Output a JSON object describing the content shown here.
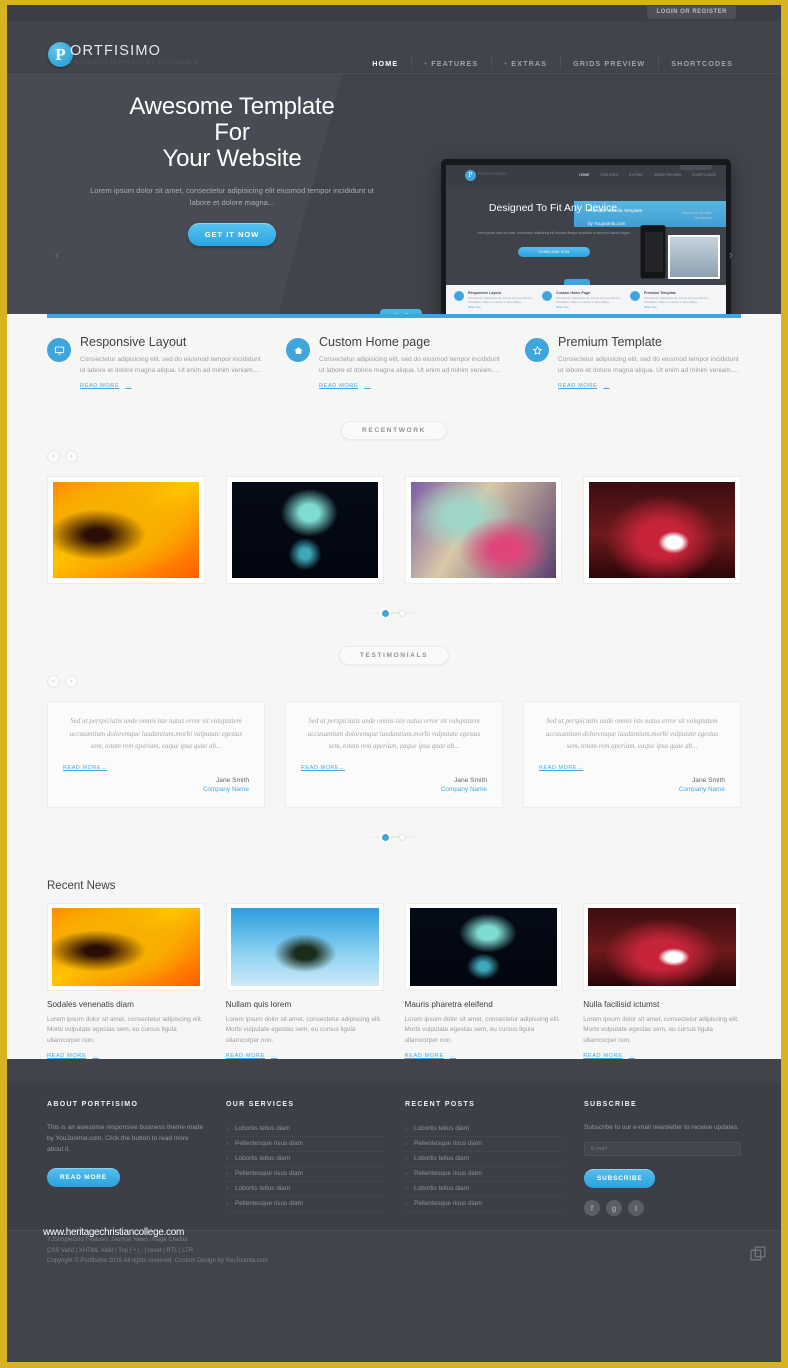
{
  "topbar": {
    "login_label": "LOGIN OR REGISTER"
  },
  "header": {
    "logo_initial": "P",
    "logo_name": "ORTFISIMO",
    "logo_tagline": "PORTFOLIO TEMPLATE BY YOUJOOMLA",
    "nav": [
      {
        "label": "HOME",
        "active": true,
        "caret": ""
      },
      {
        "label": "FEATURES",
        "active": false,
        "caret": "+"
      },
      {
        "label": "EXTRAS",
        "active": false,
        "caret": "+"
      },
      {
        "label": "GRIDS PREVIEW",
        "active": false,
        "caret": ""
      },
      {
        "label": "SHORTCODES",
        "active": false,
        "caret": ""
      }
    ]
  },
  "hero": {
    "title_line1": "Awesome Template",
    "title_line2": "For",
    "title_line3": "Your Website",
    "paragraph": "Lorem ipsum dolor sit amet, consectetur adipisicing elit eiusmod tempor incididunt ut labore et dolore magna...",
    "cta_label": "GET IT NOW",
    "prev_arrow": "‹",
    "next_arrow": "›"
  },
  "monitor": {
    "logo_initial": "P",
    "logo_text": "PORTFISIMO",
    "nav": [
      "HOME",
      "FEATURES",
      "EXTRAS",
      "GRIDS PREVIEW",
      "SHORTCODES"
    ],
    "headline": "Designed To Fit Any Device",
    "paragraph": "Lorem ipsum dolor sit amet, consectetur adipisicing elit eiusmod tempor incididunt ut labore et dolore magna.",
    "button": "DOWNLOAD NOW",
    "banner_line1": "Premium Joomla Template",
    "banner_line2": "by Youjoomla.com",
    "side_line1": "Responsive Template",
    "side_line2": "Your Website",
    "features": [
      {
        "title": "Responsive Layout",
        "text": "Consectetur adipisicing elit, sed do eiusmod tempor incididunt ut labore et dolore magna aliqua.",
        "link": "Read more"
      },
      {
        "title": "Custom Home Page",
        "text": "Consectetur adipisicing elit, sed do eiusmod tempor incididunt ut labore et dolore magna aliqua.",
        "link": "Read more"
      },
      {
        "title": "Premium Template",
        "text": "Consectetur adipisicing elit, sed do eiusmod tempor incididunt ut labore et dolore magna aliqua.",
        "link": "Read more"
      }
    ]
  },
  "features": [
    {
      "icon": "monitor-icon",
      "title": "Responsive Layout",
      "text": "Consectetur adipisicing elit, sed do eiusmod tempor incididunt ut labore et dolore magna aliqua. Ut enim ad minim veniam....",
      "link": "READ MORE"
    },
    {
      "icon": "home-icon",
      "title": "Custom Home page",
      "text": "Consectetur adipisicing elit, sed do eiusmod tempor incididunt ut labore et dolore magna aliqua. Ut enim ad minim veniam....",
      "link": "READ MORE"
    },
    {
      "icon": "star-icon",
      "title": "Premium Template",
      "text": "Consectetur adipisicing elit, sed do eiusmod tempor incididunt ut labore et dolore magna aliqua. Ut enim ad minim veniam....",
      "link": "READ MORE"
    }
  ],
  "recent_work": {
    "pill": "RECENTWORK",
    "prev": "‹",
    "next": "›",
    "items": [
      "portfolio-image-1",
      "portfolio-image-2",
      "portfolio-image-3",
      "portfolio-image-4"
    ]
  },
  "testimonials": {
    "pill": "TESTIMONIALS",
    "prev": "‹",
    "next": "›",
    "items": [
      {
        "quote": "Sed ut perspiciatis unde omnis iste natus error sit voluptatem accusantium doloremque laudantium,morbi vulputate egestas sem, totam rem aperiam, eaque ipsa quae ab...",
        "link": "READ MORE",
        "name": "Jane Smith",
        "company": "Company Name"
      },
      {
        "quote": "Sed ut perspiciatis unde omnis iste natus error sit voluptatem accusantium doloremque laudantium,morbi vulputate egestas sem, totam rem aperiam, eaque ipsa quae ab...",
        "link": "READ MORE",
        "name": "Jane Smith",
        "company": "Company Name"
      },
      {
        "quote": "Sed ut perspiciatis unde omnis iste natus error sit voluptatem accusantium doloremque laudantium,morbi vulputate egestas sem, totam rem aperiam, eaque ipsa quae ab...",
        "link": "READ MORE",
        "name": "Jane Smith",
        "company": "Company Name"
      }
    ]
  },
  "recent_news": {
    "heading": "Recent News",
    "items": [
      {
        "title": "Sodales venenatis diam",
        "text": "Lorem ipsum dolor sit amet, consectetur adipiscing elit. Morbi vulputate egestas sem, eu cursus ligula ullamcorper non.",
        "link": "READ MORE"
      },
      {
        "title": "Nullam quis lorem",
        "text": "Lorem ipsum dolor sit amet, consectetur adipiscing elit. Morbi vulputate egestas sem, eu cursus ligula ullamcorper non.",
        "link": "READ MORE"
      },
      {
        "title": "Mauris pharetra eleifend",
        "text": "Lorem ipsum dolor sit amet, consectetur adipiscing elit. Morbi vulputate egestas sem, eu cursus ligula ullamcorper non.",
        "link": "READ MORE"
      },
      {
        "title": "Nulla facilisid ictumst",
        "text": "Lorem ipsum dolor sit amet, consectetur adipiscing elit. Morbi vulputate egestas sem, eu cursus ligula ullamcorper non.",
        "link": "READ MORE"
      }
    ]
  },
  "footer": {
    "about": {
      "heading": "ABOUT PORTFISIMO",
      "text": "This is an awesome responsive business theme made by YouJoomla.com. Click the button to read more about it.",
      "button": "READ MORE"
    },
    "services": {
      "heading": "OUR SERVICES",
      "items": [
        "Lobortis tellus diam",
        "Pellentesque risus diam",
        "Lobortis tellus diam",
        "Pellentesque risus diam",
        "Lobortis tellus diam",
        "Pellentesque risus diam"
      ]
    },
    "posts": {
      "heading": "RECENT POSTS",
      "items": [
        "Lobortis tellus diam",
        "Pellentesque risus diam",
        "Lobortis tellus diam",
        "Pellentesque risus diam",
        "Lobortis tellus diam",
        "Pellentesque risus diam"
      ]
    },
    "subscribe": {
      "heading": "SUBSCRIBE",
      "text": "Subscribe to our e-mail newsletter to receive updates.",
      "placeholder": "E-mail",
      "button": "SUBSCRIBE",
      "social": [
        {
          "name": "facebook-icon",
          "glyph": "f"
        },
        {
          "name": "google-plus-icon",
          "glyph": "g"
        },
        {
          "name": "twitter-icon",
          "glyph": "t"
        }
      ]
    }
  },
  "bottom": {
    "watermark": "www.heritagechristiancollege.com",
    "line1": "YJSimpleGrid Features   Joomla! News   Image Credits",
    "line2": "CSS Valid | XHTML Valid | Top | + | - | reset | RTL | LTR",
    "line3": "Copyright © Portfisimo 2015 All rights reserved. Custom Design by YouJoomla.com"
  },
  "colors": {
    "accent": "#3fa6dc",
    "dark": "#41444c",
    "page_border": "#d8b321",
    "body_bg": "#f6f6f4"
  }
}
